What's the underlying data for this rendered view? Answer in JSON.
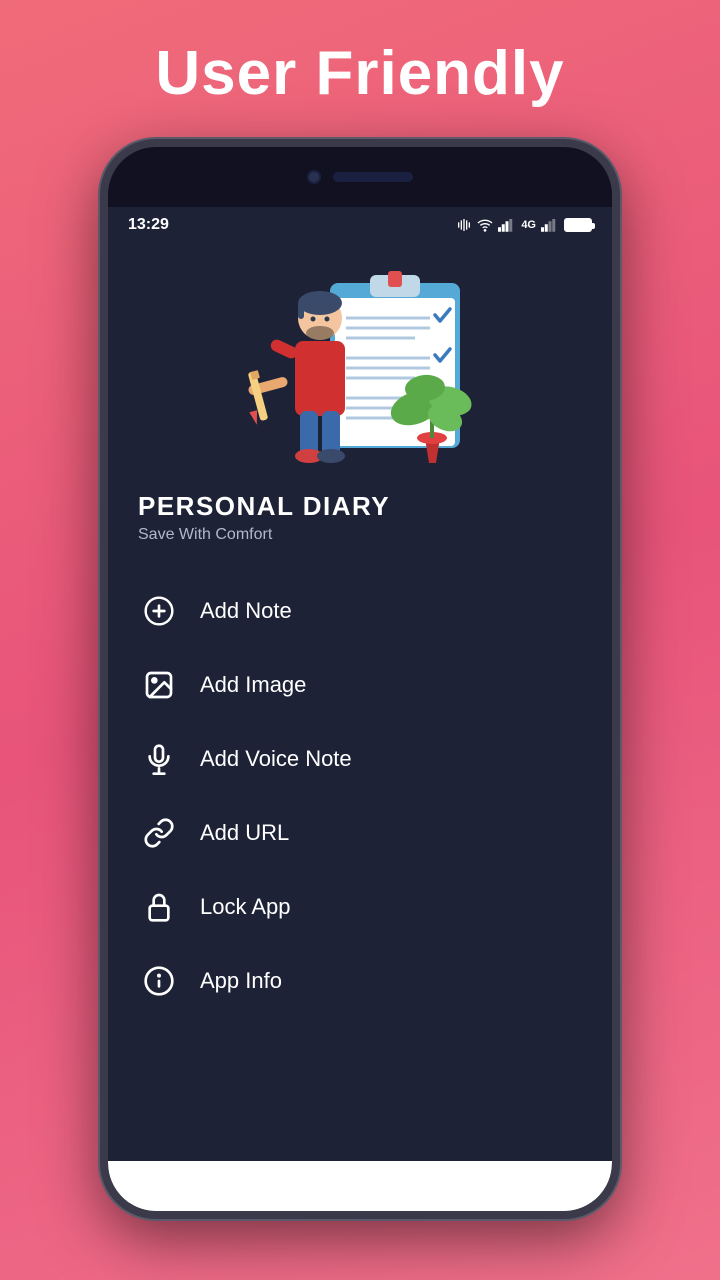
{
  "page": {
    "headline": "User Friendly",
    "background_color": "#e85c7a"
  },
  "status_bar": {
    "time": "13:29",
    "icons": [
      "vibrate",
      "wifi",
      "signal1",
      "4g",
      "signal2",
      "battery"
    ]
  },
  "app": {
    "name": "PERSONAL DIARY",
    "subtitle": "Save With Comfort"
  },
  "menu": {
    "items": [
      {
        "id": "add-note",
        "label": "Add Note",
        "icon": "add-circle"
      },
      {
        "id": "add-image",
        "label": "Add Image",
        "icon": "image"
      },
      {
        "id": "add-voice-note",
        "label": "Add Voice Note",
        "icon": "microphone"
      },
      {
        "id": "add-url",
        "label": "Add URL",
        "icon": "link"
      },
      {
        "id": "lock-app",
        "label": "Lock App",
        "icon": "lock"
      },
      {
        "id": "app-info",
        "label": "App Info",
        "icon": "info"
      }
    ]
  }
}
